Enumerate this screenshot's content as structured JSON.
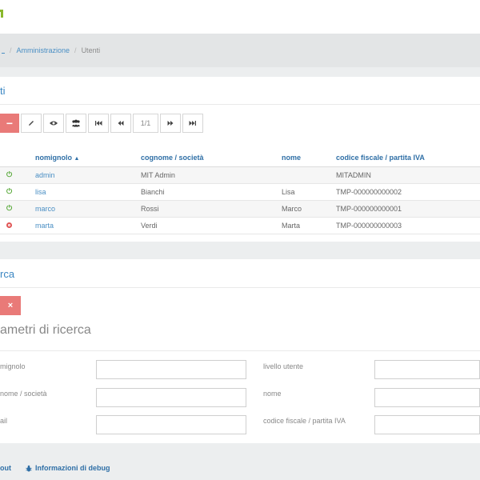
{
  "breadcrumb": {
    "items": [
      "Amministrazione",
      "Utenti"
    ]
  },
  "users_panel": {
    "title": "ti",
    "toolbar": {
      "remove_label": "−",
      "pagination": "1/1"
    },
    "table": {
      "headers": [
        "nomignolo",
        "cognome / società",
        "nome",
        "codice fiscale / partita IVA"
      ],
      "rows": [
        {
          "status": "active",
          "nickname": "admin",
          "surname": "MIT Admin",
          "name": "",
          "tax_code": "MITADMIN"
        },
        {
          "status": "active",
          "nickname": "lisa",
          "surname": "Bianchi",
          "name": "Lisa",
          "tax_code": "TMP-000000000002"
        },
        {
          "status": "active",
          "nickname": "marco",
          "surname": "Rossi",
          "name": "Marco",
          "tax_code": "TMP-000000000001"
        },
        {
          "status": "inactive",
          "nickname": "marta",
          "surname": "Verdi",
          "name": "Marta",
          "tax_code": "TMP-000000000003"
        }
      ]
    }
  },
  "search_panel": {
    "title": "rca",
    "close_label": "×",
    "heading": "ametri di ricerca",
    "fields": {
      "nickname_label": "mignolo",
      "surname_label": "nome / società",
      "email_label": "ail",
      "level_label": "livello utente",
      "name_label": "nome",
      "tax_label": "codice fiscale / partita IVA"
    }
  },
  "footer": {
    "logout": "out",
    "debug": "Informazioni di debug"
  },
  "colors": {
    "accent": "#3a86c2",
    "danger": "#e97a78",
    "active": "#59a93a",
    "logo": "#8ab82d"
  }
}
